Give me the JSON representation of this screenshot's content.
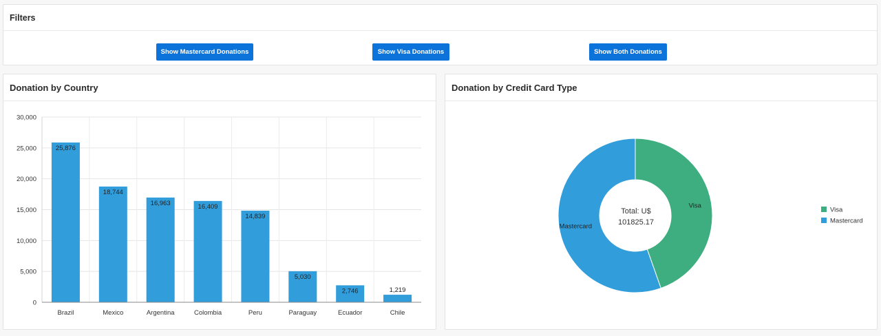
{
  "filters": {
    "title": "Filters",
    "buttons": {
      "mastercard": "Show Mastercard Donations",
      "visa": "Show Visa Donations",
      "both": "Show Both Donations"
    }
  },
  "bar_panel": {
    "title": "Donation by Country"
  },
  "pie_panel": {
    "title": "Donation by Credit Card Type"
  },
  "colors": {
    "bar": "#319ddb",
    "visa": "#3eae80",
    "mastercard": "#319ddb",
    "button": "#0b73d9"
  },
  "chart_data": [
    {
      "type": "bar",
      "title": "Donation by Country",
      "categories": [
        "Brazil",
        "Mexico",
        "Argentina",
        "Colombia",
        "Peru",
        "Paraguay",
        "Ecuador",
        "Chile"
      ],
      "values": [
        25876,
        18744,
        16963,
        16409,
        14839,
        5030,
        2746,
        1219
      ],
      "value_labels": [
        "25,876",
        "18,744",
        "16,963",
        "16,409",
        "14,839",
        "5,030",
        "2,746",
        "1,219"
      ],
      "yticks": [
        "0",
        "5,000",
        "10,000",
        "15,000",
        "20,000",
        "25,000",
        "30,000"
      ],
      "ylim": [
        0,
        30000
      ],
      "grid": true
    },
    {
      "type": "pie",
      "title": "Donation by Credit Card Type",
      "donut": true,
      "center_label": [
        "Total: U$",
        "101825.17"
      ],
      "slices": [
        {
          "name": "Visa",
          "fraction": 0.446
        },
        {
          "name": "Mastercard",
          "fraction": 0.554
        }
      ],
      "legend": [
        "Visa",
        "Mastercard"
      ],
      "legend_position": "right"
    }
  ]
}
